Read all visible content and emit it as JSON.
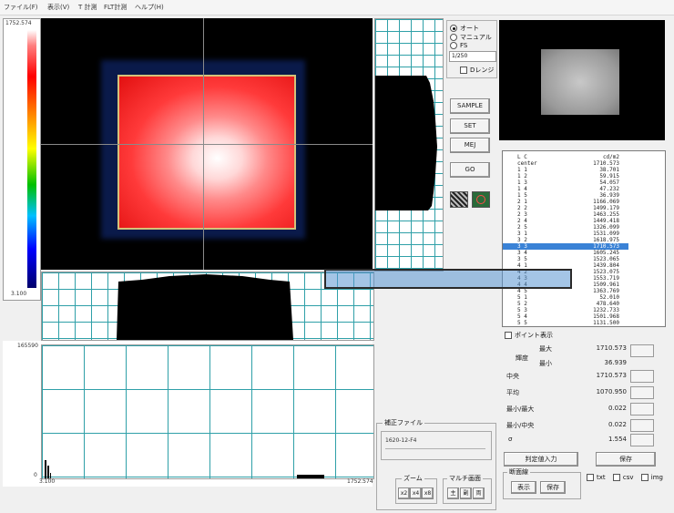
{
  "menu": [
    {
      "label": "ファイル(F)"
    },
    {
      "label": "表示(V)"
    },
    {
      "label": "T 計測"
    },
    {
      "label": "FLT計測"
    },
    {
      "label": "ヘルプ(H)"
    }
  ],
  "colorscale": {
    "max_label": "1752.574",
    "min_label": "3.100"
  },
  "histogram": {
    "y_max_label": "165590",
    "y_min_label": "0",
    "x_min_label": "3.100",
    "x_max_label": "1752.574"
  },
  "mode": {
    "options": [
      {
        "label": "オート",
        "selected": true
      },
      {
        "label": "マニュアル",
        "selected": false
      },
      {
        "label": "FS",
        "selected": false
      }
    ],
    "shutter": "1/250",
    "drange_label": "Dレンジ"
  },
  "buttons": {
    "sample": "SAMPLE",
    "set": "SET",
    "mej": "MEJ",
    "go": "GO"
  },
  "list": {
    "header_left": "L C",
    "header_right": "cd/m2",
    "rows": [
      {
        "l": "center",
        "r": "1710.573"
      },
      {
        "l": "1  1",
        "r": "38.701"
      },
      {
        "l": "1  2",
        "r": "59.915"
      },
      {
        "l": "1  3",
        "r": "54.057"
      },
      {
        "l": "1  4",
        "r": "47.232"
      },
      {
        "l": "1  5",
        "r": "36.939"
      },
      {
        "l": "2  1",
        "r": "1166.069"
      },
      {
        "l": "2  2",
        "r": "1499.179"
      },
      {
        "l": "2  3",
        "r": "1463.255"
      },
      {
        "l": "2  4",
        "r": "1449.418"
      },
      {
        "l": "2  5",
        "r": "1326.099"
      },
      {
        "l": "3  1",
        "r": "1531.099"
      },
      {
        "l": "3  2",
        "r": "1618.975"
      },
      {
        "l": "3  3",
        "r": "1710.573"
      },
      {
        "l": "3  4",
        "r": "1605.245"
      },
      {
        "l": "3  5",
        "r": "1523.065"
      },
      {
        "l": "4  1",
        "r": "1439.804"
      },
      {
        "l": "4  2",
        "r": "1523.075"
      },
      {
        "l": "4  3",
        "r": "1553.719"
      },
      {
        "l": "4  4",
        "r": "1509.961"
      },
      {
        "l": "4  5",
        "r": "1363.769"
      },
      {
        "l": "5  1",
        "r": "52.010"
      },
      {
        "l": "5  2",
        "r": "478.640"
      },
      {
        "l": "5  3",
        "r": "1232.733"
      },
      {
        "l": "5  4",
        "r": "1501.968"
      },
      {
        "l": "5  5",
        "r": "1131.500"
      }
    ]
  },
  "stats": {
    "point_display_label": "ポイント表示",
    "luminance_label": "輝度",
    "max_label": "最大",
    "max_value": "1710.573",
    "min_label": "最小",
    "min_value": "36.939",
    "center_label": "中央",
    "center_value": "1710.573",
    "avg_label": "平均",
    "avg_value": "1070.950",
    "min_max_label": "最小/最大",
    "min_max_value": "0.022",
    "min_center_label": "最小/中央",
    "min_center_value": "0.022",
    "sigma_label": "σ",
    "sigma_value": "1.554"
  },
  "judge_button": "判定値入力",
  "save_button": "保存",
  "correction": {
    "title": "補正ファイル",
    "value": "1620-12-F4"
  },
  "zoom": {
    "title": "ズーム",
    "x2": "x2",
    "x4": "x4",
    "x8": "x8"
  },
  "multi": {
    "title": "マルチ画面",
    "b1": "主",
    "b2": "副",
    "b3": "両"
  },
  "section": {
    "title": "断面線",
    "show": "表示",
    "save": "保存"
  },
  "export": {
    "txt": "txt",
    "csv": "csv",
    "img": "img"
  }
}
